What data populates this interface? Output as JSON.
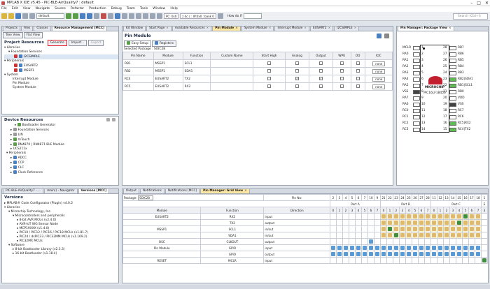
{
  "window": {
    "title": "MPLAB X IDE v5.45 - PIC-BLE-AirQuality7 : default"
  },
  "menu": [
    "File",
    "Edit",
    "View",
    "Navigate",
    "Source",
    "Refactor",
    "Production",
    "Debug",
    "Team",
    "Tools",
    "Window",
    "Help"
  ],
  "toolbar": {
    "config": "default",
    "pcl": "PC: 0x0",
    "status": "z dc c : W:0x0 : bank 0",
    "howdoi": "How do I?"
  },
  "search": {
    "placeholder": "Search (Ctrl+I)"
  },
  "left": {
    "tabs": [
      "Projects",
      "Files",
      "Classes",
      "Resource Management [MCC]"
    ],
    "subtabs": [
      "Tree View",
      "Flat View"
    ],
    "header": "Project Resources",
    "buttons": {
      "generate": "Generate",
      "import": "Import...",
      "export": "Export"
    },
    "tree": [
      "Libraries",
      "Foundation Services",
      "I2CSIMPLE",
      "Peripherals",
      "EUSART2",
      "MSSP1",
      "System",
      "Interrupt Module",
      "Pin Module",
      "System Module"
    ]
  },
  "devres": {
    "header": "Device Resources",
    "tree": [
      "Bootloader Generator",
      "Foundation Services",
      "LIN",
      "mTouch",
      "RN4870 | RN4871 BLE Module",
      "UCS211x",
      "Peripherals",
      "ADCC",
      "CCP",
      "CLC",
      "Clock Reference"
    ]
  },
  "lowleft": {
    "tabs": [
      "PIC-BLE-AirQuality7 - ...",
      "main() - Navigator",
      "Versions [MCC]"
    ],
    "header": "Versions",
    "tree": [
      "MPLAB® Code Configurator (Plugin) v4.0.2",
      "Libraries",
      "Microchip Technology, Inc.",
      "Microcontrollers and peripherals",
      "8-bit AVR MCUs (v2.4.0)",
      "AVR-IoT WG Sensor Node",
      "MCP19XXX (v1.4.0)",
      "PIC10 / PIC12 / PIC16 / PIC18 MCUs (v1.81.7)",
      "PIC24 / dsPIC33 / PIC32MM MCUs (v1.169.2)",
      "PIC32MX MCUs",
      "Software",
      "8-bit Bootloader Library (v2.3.3)",
      "16-bit Bootloader (v1.18.4)"
    ]
  },
  "editor": {
    "tabs": [
      "Start Page",
      "Available Resources",
      "Pin Module",
      "System Module",
      "Interrupt Module",
      "EUSART2",
      "I2CSIMPLE"
    ],
    "kit": "Kit Window"
  },
  "pinmodule": {
    "title": "Pin Module",
    "subtabs": [
      "Easy Setup",
      "Registers"
    ],
    "pkglabel": "Selected Package : SOIC28",
    "columns": [
      "Pin Name",
      "Module",
      "Function",
      "Custom Name",
      "Start High",
      "Analog",
      "Output",
      "WPU",
      "OD",
      "IOC"
    ],
    "rows": [
      {
        "pin": "RB1",
        "module": "MSSP1",
        "func": "SCL1",
        "analog": false,
        "output": false,
        "ioc": "none"
      },
      {
        "pin": "RB2",
        "module": "MSSP1",
        "func": "SDA1",
        "analog": false,
        "output": false,
        "ioc": "none"
      },
      {
        "pin": "RC4",
        "module": "EUSART2",
        "func": "TX2",
        "analog": true,
        "output": true,
        "ioc": "none"
      },
      {
        "pin": "RC5",
        "module": "EUSART2",
        "func": "RX2",
        "analog": false,
        "output": false,
        "ioc": "none"
      }
    ]
  },
  "pkgview": {
    "tab": "Pin Manager: Package View",
    "chip": "PIC16LF18456",
    "left": [
      "MCLR",
      "RA0",
      "RA1",
      "RA2",
      "RA3",
      "RA4",
      "RA5",
      "VSS",
      "RA7",
      "RA6",
      "RC0",
      "RC1",
      "RC2",
      "RC3"
    ],
    "leftnums": [
      "1",
      "2",
      "3",
      "4",
      "5",
      "6",
      "7",
      "8",
      "9",
      "10",
      "11",
      "12",
      "13",
      "14"
    ],
    "right": [
      "RB7",
      "RB6",
      "RB5",
      "RB4",
      "RB3",
      "RB2|SDA1",
      "RB1|SCL1",
      "RB0",
      "VDD",
      "VSS",
      "RC7",
      "RC6",
      "RC5|RX2",
      "RC4|TX2"
    ],
    "rightnums": [
      "28",
      "27",
      "26",
      "25",
      "24",
      "23",
      "22",
      "21",
      "20",
      "19",
      "18",
      "17",
      "16",
      "15"
    ]
  },
  "bottom": {
    "tabs": [
      "Output",
      "Notifications",
      "Notifications [MCC]",
      "Pin Manager: Grid View"
    ],
    "package": "SOIC28",
    "pinno": "Pin No:",
    "pinnos": [
      "2",
      "3",
      "4",
      "5",
      "6",
      "7",
      "10",
      "9",
      "21",
      "22",
      "23",
      "24",
      "25",
      "26",
      "27",
      "28",
      "11",
      "12",
      "13",
      "14",
      "15",
      "16",
      "17",
      "18",
      "1"
    ],
    "ports": [
      "Port A",
      "Port B",
      "Port C",
      "E"
    ],
    "bits": [
      "0",
      "1",
      "2",
      "3",
      "4",
      "5",
      "6",
      "7",
      "0",
      "1",
      "2",
      "3",
      "4",
      "5",
      "6",
      "7",
      "0",
      "1",
      "2",
      "3",
      "4",
      "5",
      "6",
      "7",
      "3"
    ],
    "cols": [
      "Module",
      "Function",
      "Direction"
    ],
    "rows": [
      {
        "module": "EUSART2",
        "func": "RX2",
        "dir": "input"
      },
      {
        "module": "",
        "func": "TX2",
        "dir": "output"
      },
      {
        "module": "MSSP1",
        "func": "SCL1",
        "dir": "in/out"
      },
      {
        "module": "",
        "func": "SDA1",
        "dir": "in/out"
      },
      {
        "module": "OSC",
        "func": "CLKOUT",
        "dir": "output"
      },
      {
        "module": "Pin Module",
        "func": "GPIO",
        "dir": "input"
      },
      {
        "module": "",
        "func": "GPIO",
        "dir": "output"
      },
      {
        "module": "RESET",
        "func": "MCLR",
        "dir": "input"
      }
    ]
  }
}
